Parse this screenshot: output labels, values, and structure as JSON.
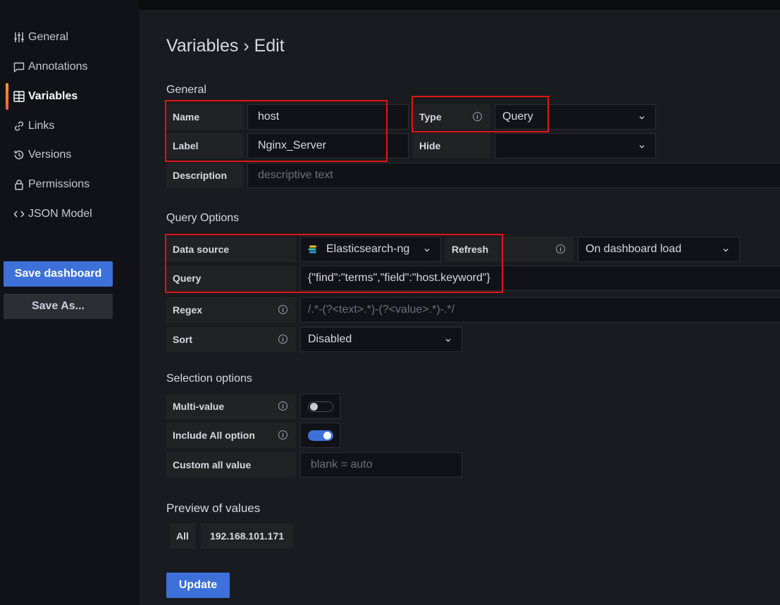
{
  "sidebar": {
    "items": [
      {
        "label": "General",
        "icon": "sliders-icon"
      },
      {
        "label": "Annotations",
        "icon": "comment-icon"
      },
      {
        "label": "Variables",
        "icon": "variables-grid-icon"
      },
      {
        "label": "Links",
        "icon": "link-icon"
      },
      {
        "label": "Versions",
        "icon": "history-icon"
      },
      {
        "label": "Permissions",
        "icon": "lock-icon"
      },
      {
        "label": "JSON Model",
        "icon": "code-brackets-icon"
      }
    ],
    "active": "Variables",
    "save_label": "Save dashboard",
    "save_as_label": "Save As..."
  },
  "page": {
    "title": "Variables › Edit"
  },
  "general": {
    "heading": "General",
    "name_label": "Name",
    "name_value": "host",
    "type_label": "Type",
    "type_value": "Query",
    "label_label": "Label",
    "label_value": "Nginx_Server",
    "hide_label": "Hide",
    "hide_value": "",
    "description_label": "Description",
    "description_placeholder": "descriptive text"
  },
  "query_options": {
    "heading": "Query Options",
    "datasource_label": "Data source",
    "datasource_value": "Elasticsearch-ng",
    "refresh_label": "Refresh",
    "refresh_value": "On dashboard load",
    "query_label": "Query",
    "query_value": "{\"find\":\"terms\",\"field\":\"host.keyword\"}",
    "regex_label": "Regex",
    "regex_placeholder": "/.*-(?<text>.*)-(?<value>.*)-.*/",
    "sort_label": "Sort",
    "sort_value": "Disabled"
  },
  "selection": {
    "heading": "Selection options",
    "multi_label": "Multi-value",
    "multi_enabled": false,
    "include_all_label": "Include All option",
    "include_all_enabled": true,
    "custom_all_label": "Custom all value",
    "custom_all_placeholder": "blank = auto"
  },
  "preview": {
    "heading": "Preview of values",
    "values": [
      "All",
      "192.168.101.171"
    ]
  },
  "actions": {
    "update_label": "Update"
  },
  "colors": {
    "primary": "#3d71d9",
    "highlight": "#e01616",
    "accent_bar": "#ff9830"
  }
}
